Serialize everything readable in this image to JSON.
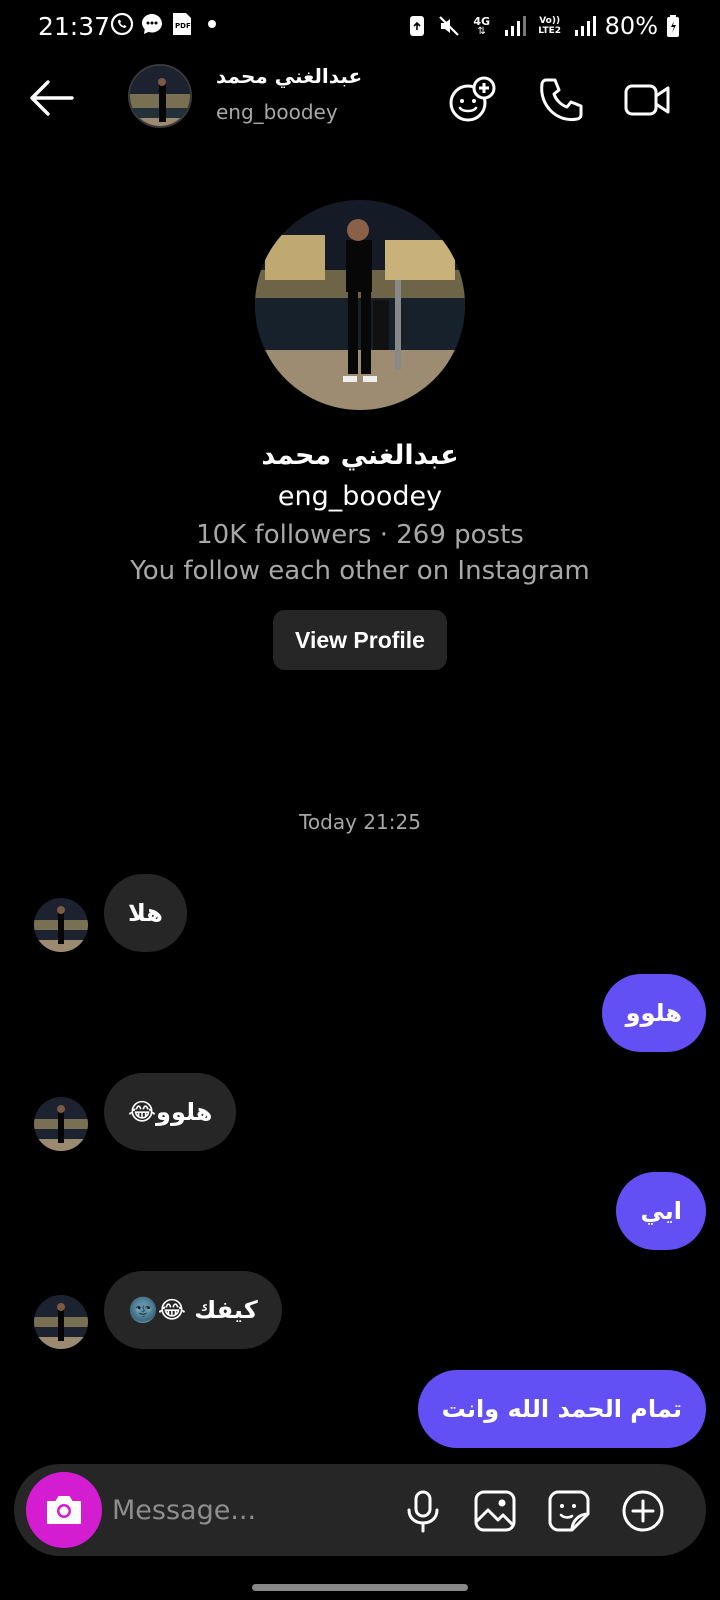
{
  "status_bar": {
    "time": "21:37",
    "left_icons": [
      "whatsapp-icon",
      "chat-icon",
      "pdf-icon",
      "dot-icon"
    ],
    "right_icons": [
      "recycle-icon",
      "mute-icon",
      "4g-icon",
      "signal-icon",
      "volte-icon",
      "signal-icon"
    ],
    "network_4g": "4G",
    "volte": "Vo)) LTE2",
    "battery": "80%"
  },
  "header": {
    "display_name": "عبدالغني محمد",
    "username": "eng_boodey"
  },
  "profile": {
    "display_name": "عبدالغني محمد",
    "username": "eng_boodey",
    "stats": "10K followers · 269 posts",
    "mutual": "You follow each other on Instagram",
    "view_profile_label": "View Profile"
  },
  "conversation": {
    "timestamp": "Today 21:25",
    "messages": [
      {
        "direction": "in",
        "text": "هلا"
      },
      {
        "direction": "out",
        "text": "هلوو"
      },
      {
        "direction": "in",
        "text": "هلوو😂"
      },
      {
        "direction": "out",
        "text": "ايي"
      },
      {
        "direction": "in",
        "text": "كيفك 😂🌚"
      },
      {
        "direction": "out",
        "text": "تمام الحمد الله وانت"
      }
    ]
  },
  "composer": {
    "placeholder": "Message..."
  },
  "colors": {
    "background": "#000000",
    "incoming_bubble": "#262626",
    "outgoing_bubble": "#6350f4",
    "camera_button": "#d41cd1",
    "secondary_text": "#a8a8a8"
  }
}
